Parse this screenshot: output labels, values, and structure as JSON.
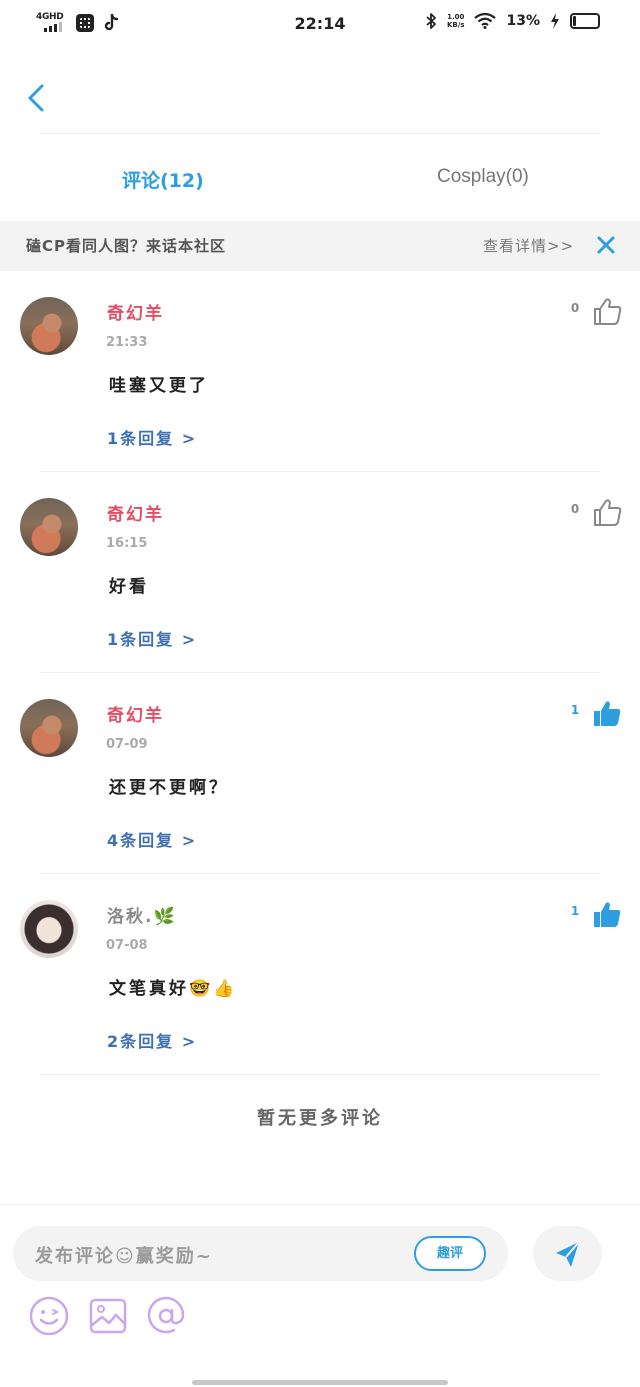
{
  "status_bar": {
    "network": "4GHD",
    "time": "22:14",
    "speed_value": "1.00",
    "speed_unit": "KB/s",
    "battery": "13%",
    "battery_level": 0.13
  },
  "tabs": [
    {
      "label": "评论(12)",
      "active": true
    },
    {
      "label": "Cosplay(0)",
      "active": false
    }
  ],
  "banner": {
    "text": "磕CP看同人图？来话本社区",
    "link": "查看详情>>"
  },
  "comments": [
    {
      "username": "奇幻羊",
      "time": "21:33",
      "text": "哇塞又更了",
      "replies": "1条回复 >",
      "likes": "0",
      "liked": false
    },
    {
      "username": "奇幻羊",
      "time": "16:15",
      "text": "好看",
      "replies": "1条回复 >",
      "likes": "0",
      "liked": false
    },
    {
      "username": "奇幻羊",
      "time": "07-09",
      "text": "还更不更啊？",
      "replies": "4条回复 >",
      "likes": "1",
      "liked": true
    },
    {
      "username": "洛秋.🌿",
      "time": "07-08",
      "text": "文笔真好🤓👍",
      "replies": "2条回复 >",
      "likes": "1",
      "liked": true
    }
  ],
  "footer_note": "暂无更多评论",
  "composer": {
    "placeholder": "发布评论☺赢奖励~",
    "quick_button": "趣评"
  },
  "colors": {
    "accent": "#2d9fe0",
    "username_red": "#e34d64",
    "reply_link": "#3e6fb4",
    "tool_purple": "#c9a7ef"
  }
}
